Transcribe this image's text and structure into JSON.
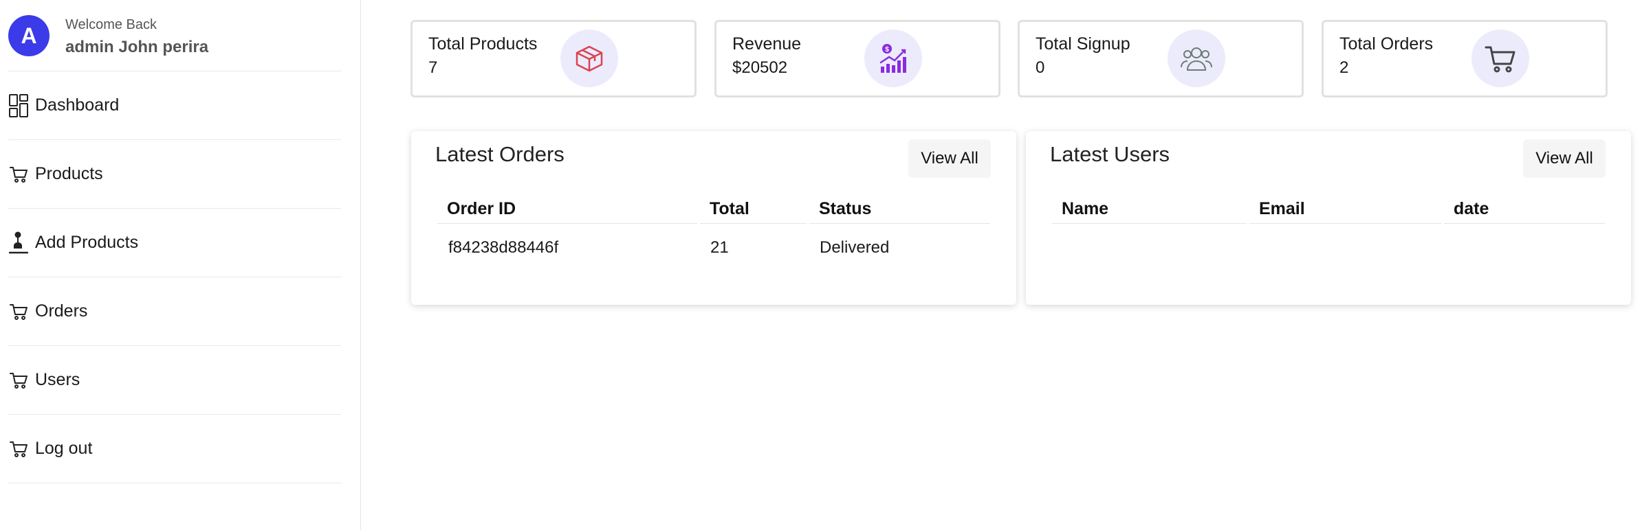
{
  "profile": {
    "avatar_letter": "A",
    "welcome": "Welcome Back",
    "name": "admin John perira"
  },
  "sidebar": {
    "items": [
      {
        "label": "Dashboard",
        "icon": "dashboard-grid-icon"
      },
      {
        "label": "Products",
        "icon": "cart-icon"
      },
      {
        "label": "Add Products",
        "icon": "joystick-icon"
      },
      {
        "label": "Orders",
        "icon": "cart-icon"
      },
      {
        "label": "Users",
        "icon": "cart-icon"
      },
      {
        "label": "Log out",
        "icon": "cart-icon"
      }
    ]
  },
  "stats": [
    {
      "label": "Total Products",
      "value": "7",
      "icon": "package-box-icon",
      "icon_color": "#d9434f"
    },
    {
      "label": "Revenue",
      "value": "$20502",
      "icon": "revenue-chart-icon",
      "icon_color": "#8a2be2"
    },
    {
      "label": "Total Signup",
      "value": "0",
      "icon": "users-group-icon",
      "icon_color": "#6b7b74"
    },
    {
      "label": "Total Orders",
      "value": "2",
      "icon": "shopping-cart-icon",
      "icon_color": "#444444"
    }
  ],
  "latest_orders": {
    "title": "Latest Orders",
    "view_all": "View All",
    "columns": [
      "Order ID",
      "Total",
      "Status"
    ],
    "rows": [
      [
        "f84238d88446f",
        "21",
        "Delivered"
      ]
    ]
  },
  "latest_users": {
    "title": "Latest Users",
    "view_all": "View All",
    "columns": [
      "Name",
      "Email",
      "date"
    ],
    "rows": []
  },
  "colors": {
    "accent": "#3b3bea",
    "icon_bg": "#ecebfc"
  }
}
